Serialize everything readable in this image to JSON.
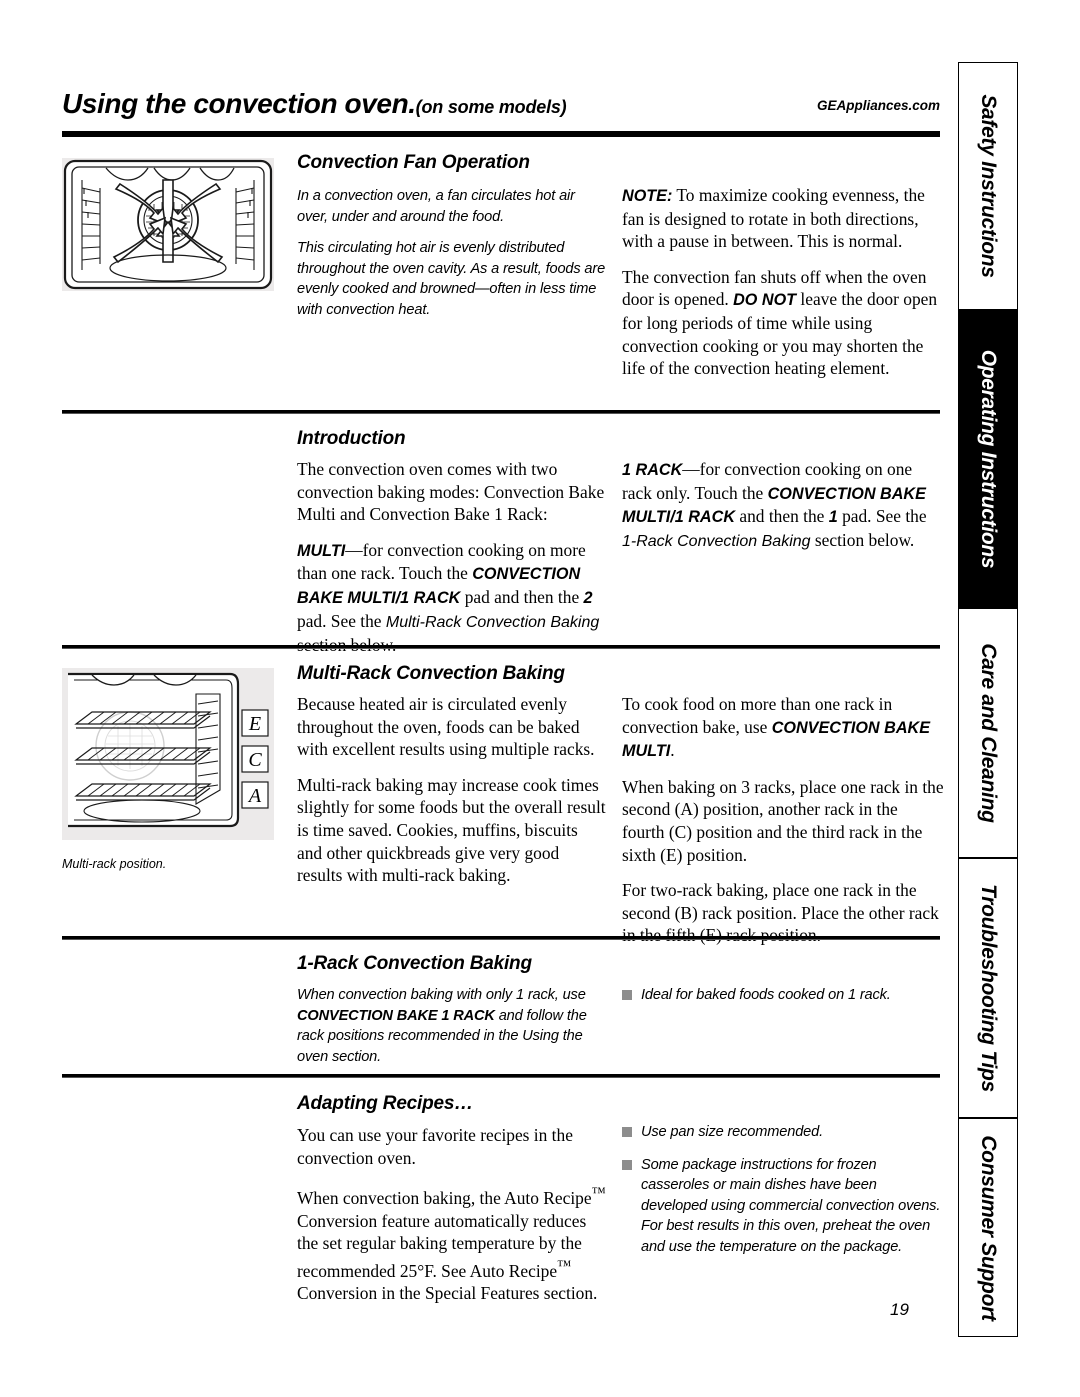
{
  "header": {
    "title": "Using the convection oven.",
    "subtitle": "(on some models)",
    "website": "GEAppliances.com"
  },
  "sections": {
    "fan": {
      "heading": "Convection Fan Operation",
      "left_p1": "In a convection oven, a fan circulates hot air over, under and around the food.",
      "left_p2": "This circulating hot air is evenly distributed throughout the oven cavity. As a result, foods are evenly cooked and browned—often in less time with convection heat.",
      "note_label": "NOTE:",
      "note_text": " To maximize cooking evenness, the fan is designed to rotate in both directions, with a pause in between. This is normal.",
      "right_p2_a": "The convection fan shuts off when the oven door is opened. ",
      "right_p2_emph": "DO NOT",
      "right_p2_b": " leave the door open for long periods of time while using convection cooking or you may shorten the life of the convection heating element."
    },
    "introduction": {
      "heading": "Introduction",
      "left_p1": "The convection oven comes with two convection baking modes: Convection Bake Multi and Convection Bake 1 Rack:",
      "multi_label": "MULTI",
      "multi_a": "—for convection cooking on more than one rack. Touch the ",
      "multi_pad": "CONVECTION BAKE MULTI/1 RACK",
      "multi_b": " pad and then the ",
      "multi_num": "2",
      "multi_c": " pad. See the ",
      "multi_ref": "Multi-Rack Convection Baking",
      "multi_d": " section below.",
      "rack_label": "1 RACK",
      "rack_a": "—for convection cooking on one rack only. Touch the ",
      "rack_pad": "CONVECTION BAKE MULTI/1 RACK",
      "rack_b": " and then the ",
      "rack_num": "1",
      "rack_c": " pad. See the ",
      "rack_ref": "1-Rack Convection Baking",
      "rack_d": " section below."
    },
    "multirack": {
      "heading": "Multi-Rack Convection Baking",
      "left_p1": "Because heated air is circulated evenly throughout the oven, foods can be baked with excellent results using multiple racks.",
      "left_p2": "Multi-rack baking may increase cook times slightly for some foods but the overall result is time saved. Cookies, muffins, biscuits and other quickbreads give very good results with multi-rack baking.",
      "right_p1_a": "To cook food on more than one rack in convection bake, use ",
      "right_p1_emph": "CONVECTION BAKE MULTI",
      "right_p1_b": ".",
      "right_p2": "When baking on 3 racks, place one rack in the second (A) position, another rack in the fourth (C) position and the third rack in the sixth (E) position.",
      "right_p3": "For two-rack baking, place one rack in the second (B) rack position. Place the other rack in the fifth (E) rack position.",
      "figure_caption": "Multi-rack position.",
      "rack_labels": [
        "E",
        "C",
        "A"
      ]
    },
    "onerack": {
      "heading": "1-Rack Convection Baking",
      "left_a": "When convection baking with only 1 rack, use ",
      "left_emph": "CONVECTION BAKE 1 RACK",
      "left_b": " and follow the rack positions recommended in the Using the oven section.",
      "bullets": [
        "Ideal for baked foods cooked on 1 rack."
      ]
    },
    "adapting": {
      "heading": "Adapting Recipes…",
      "left_p1": "You can use your favorite recipes in the convection oven.",
      "left_p2_a": "When convection baking, the Auto Recipe",
      "left_p2_tm": "™",
      "left_p2_b": " Conversion feature automatically reduces the set regular baking temperature by the recommended 25°F. See Auto Recipe",
      "left_p2_tm2": "™",
      "left_p2_c": " Conversion in the Special Features section.",
      "bullets": [
        "Use pan size recommended.",
        "Some package instructions for frozen casseroles or main dishes have been developed using commercial convection ovens. For best results in this oven, preheat the oven and use the temperature on the package."
      ]
    }
  },
  "rail": {
    "tabs": [
      {
        "label": "Safety Instructions",
        "active": false
      },
      {
        "label": "Operating Instructions",
        "active": true
      },
      {
        "label": "Care and Cleaning",
        "active": false
      },
      {
        "label": "Troubleshooting Tips",
        "active": false
      },
      {
        "label": "Consumer Support",
        "active": false
      }
    ]
  },
  "page_number": "19",
  "colors": {
    "rule": "#000000",
    "bullet": "#8d8d8d",
    "figure_bg": "#eceaea",
    "active_tab_bg": "#000000"
  }
}
